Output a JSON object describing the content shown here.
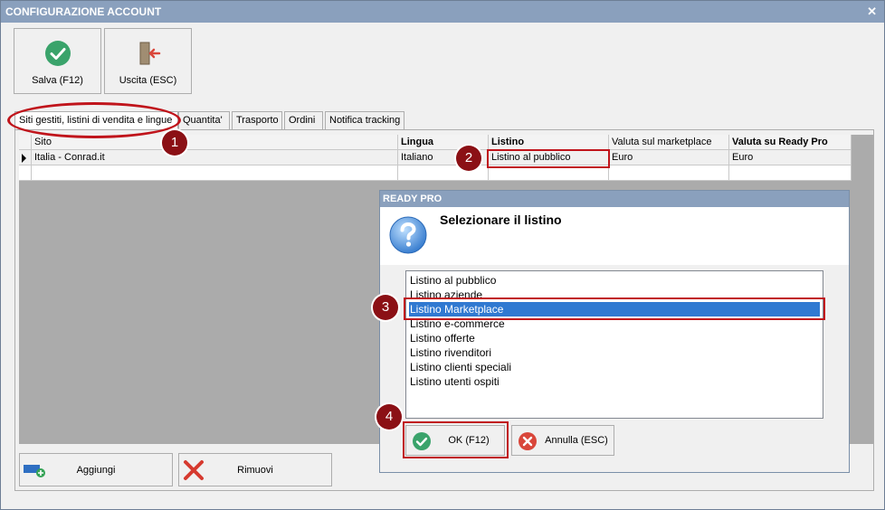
{
  "window": {
    "title": "CONFIGURAZIONE ACCOUNT",
    "close_glyph": "✕"
  },
  "toolbar": {
    "save_label": "Salva (F12)",
    "save_icon": "check-circle-icon",
    "exit_label": "Uscita (ESC)",
    "exit_icon": "door-exit-icon"
  },
  "tabs": [
    {
      "label": "Siti gestiti, listini di vendita e lingue",
      "active": true
    },
    {
      "label": "Quantita'",
      "active": false
    },
    {
      "label": "Trasporto",
      "active": false
    },
    {
      "label": "Ordini",
      "active": false
    },
    {
      "label": "Notifica tracking",
      "active": false
    }
  ],
  "grid": {
    "columns": [
      "Sito",
      "Lingua",
      "Listino",
      "Valuta sul marketplace",
      "Valuta su Ready Pro"
    ],
    "rows": [
      {
        "sito": "Italia - Conrad.it",
        "lingua": "Italiano",
        "listino": "Listino al pubblico",
        "valuta_marketplace": "Euro",
        "valuta_readypro": "Euro"
      }
    ]
  },
  "badges": [
    "1",
    "2",
    "3",
    "4"
  ],
  "dialog": {
    "title": "READY PRO",
    "message": "Selezionare il listino",
    "icon": "question-icon",
    "options": [
      "Listino al pubblico",
      "Listino aziende",
      "Listino Marketplace",
      "Listino e-commerce",
      "Listino offerte",
      "Listino rivenditori",
      "Listino clienti speciali",
      "Listino utenti ospiti"
    ],
    "selected": "Listino Marketplace",
    "ok_label": "OK (F12)",
    "cancel_label": "Annulla (ESC)"
  },
  "bottom": {
    "add_label": "Aggiungi",
    "remove_label": "Rimuovi"
  },
  "colors": {
    "accent_red": "#c0141b",
    "badge": "#8b1015",
    "selection": "#3079d1",
    "title_bar": "#8aa0bd"
  }
}
